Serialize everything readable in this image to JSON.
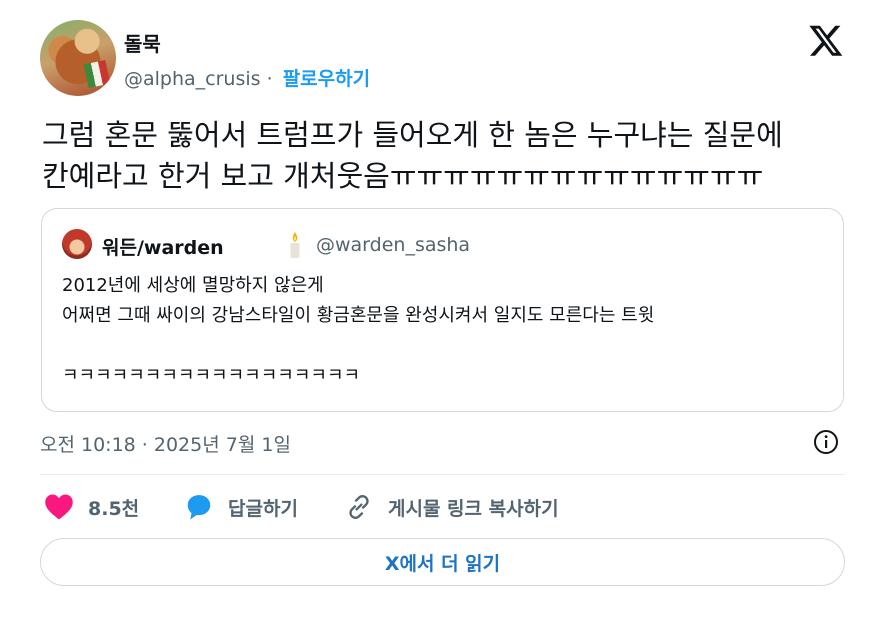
{
  "author": {
    "display_name": "돌묵",
    "handle": "@alpha_crusis",
    "separator": "·",
    "follow_label": "팔로우하기"
  },
  "tweet": {
    "lines": [
      "그럼 혼문 뚫어서 트럼프가 들어오게 한 놈은 누구냐는 질문에",
      "칸예라고 한거 보고 개처웃음ㅠㅠㅠㅠㅠㅠㅠㅠㅠㅠㅠㅠㅠㅠ"
    ]
  },
  "quoted_tweet": {
    "display_name": "워든/warden",
    "badge_icon": "candle-icon",
    "handle": "@warden_sasha",
    "lines": [
      "2012년에 세상에 멸망하지 않은게",
      "어쩌면 그때 싸이의 강남스타일이 황금혼문을 완성시켜서 일지도 모른다는 트윗",
      "",
      "ㅋㅋㅋㅋㅋㅋㅋㅋㅋㅋㅋㅋㅋㅋㅋㅋㅋㅋ"
    ]
  },
  "timestamp": "오전 10:18 · 2025년 7월 1일",
  "actions": {
    "like_count": "8.5천",
    "reply_label": "답글하기",
    "copy_link_label": "게시물 링크 복사하기"
  },
  "read_more_label": "X에서 더 읽기",
  "colors": {
    "accent": "#1d9bf0",
    "like": "#f91880",
    "muted": "#536471",
    "border": "#cfd9de"
  }
}
